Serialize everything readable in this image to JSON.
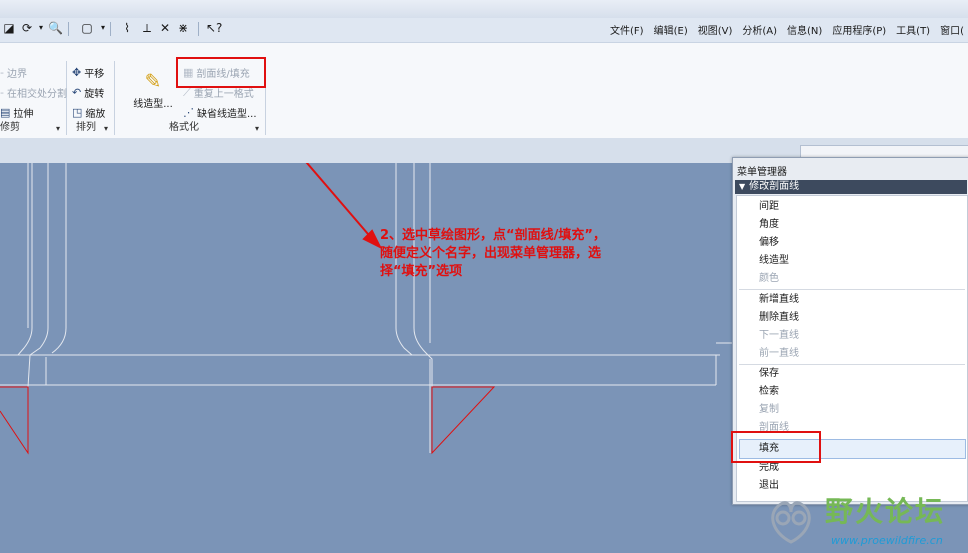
{
  "titlebar": {
    "title": ""
  },
  "menubar": {
    "items": [
      "文件(F)",
      "编辑(E)",
      "视图(V)",
      "分析(A)",
      "信息(N)",
      "应用程序(P)",
      "工具(T)",
      "窗口("
    ]
  },
  "ribbon": {
    "group1": {
      "items": [
        "边界",
        "在相交处分割",
        "拉伸"
      ],
      "label": "修剪"
    },
    "group2": {
      "items": [
        "平移",
        "旋转",
        "缩放"
      ],
      "label": "排列"
    },
    "group3": {
      "big_button": "线造型...",
      "items": [
        "剖面线/填充",
        "重复上一格式",
        "缺省线造型..."
      ],
      "label": "格式化"
    }
  },
  "annotation": {
    "lines": [
      "2、选中草绘图形，点“剖面线/填充”，",
      "随便定义个名字，出现菜单管理器，选",
      "择“填充”选项"
    ]
  },
  "menu_manager": {
    "title": "菜单管理器",
    "header": "修改剖面线",
    "items": [
      {
        "label": "间距",
        "enabled": true
      },
      {
        "label": "角度",
        "enabled": true
      },
      {
        "label": "偏移",
        "enabled": true
      },
      {
        "label": "线造型",
        "enabled": true
      },
      {
        "label": "颜色",
        "enabled": false
      },
      {
        "label": "新增直线",
        "enabled": true
      },
      {
        "label": "删除直线",
        "enabled": true
      },
      {
        "label": "下一直线",
        "enabled": false
      },
      {
        "label": "前一直线",
        "enabled": false
      },
      {
        "label": "保存",
        "enabled": true
      },
      {
        "label": "检索",
        "enabled": true
      },
      {
        "label": "复制",
        "enabled": false
      },
      {
        "label": "剖面线",
        "enabled": false
      },
      {
        "label": "填充",
        "enabled": true,
        "selected": true
      },
      {
        "label": "完成",
        "enabled": true
      },
      {
        "label": "退出",
        "enabled": true
      }
    ]
  },
  "watermark": {
    "title": "野火论坛",
    "url": "www.proewildfire.cn"
  },
  "colors": {
    "canvas": "#7b94b7",
    "annotation": "#e01010",
    "highlight": "#e01010"
  }
}
